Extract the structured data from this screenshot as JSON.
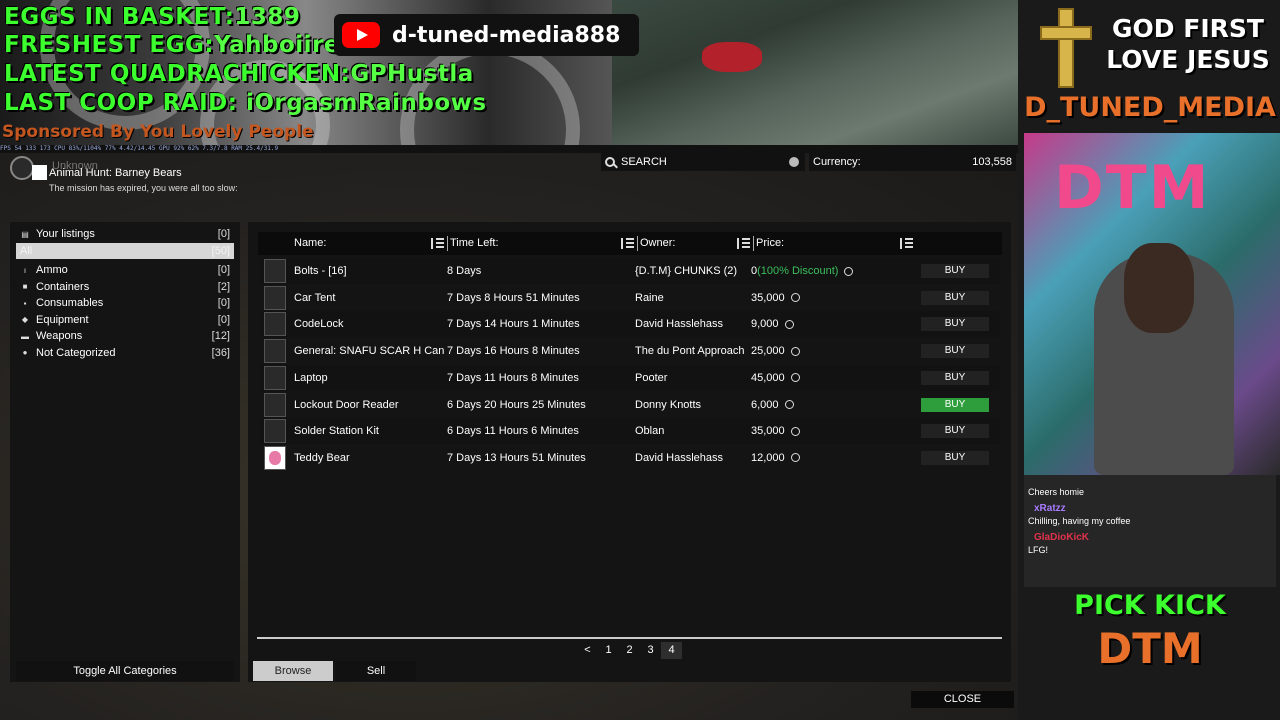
{
  "overlay": {
    "eggs_label": "EGGS IN BASKET:",
    "eggs_value": "1389",
    "freshest_label": "FRESHEST EGG:",
    "freshest_value": "Yahboiirec",
    "quadra_label": "LATEST QUADRACHICKEN:",
    "quadra_value": "GPHustla",
    "raid_label": "LAST COOP RAID:",
    "raid_value": "iOrgasmRainbows",
    "sponsor": "Sponsored By You Lovely People",
    "channel": "d-tuned-media888",
    "perf": "FPS 54  133 173   CPU 83%/1104%  77%  4.42/14.45  GPU 92%  62%  7.3/7.8  RAM 25.4/31.9",
    "god_line1": "GOD FIRST",
    "god_line2": "LOVE JESUS",
    "brand": "D_TUNED_MEDIA",
    "pick_line": "PICK KICK",
    "pick_brand": "DTM",
    "chat": [
      {
        "user": "",
        "message": "Cheers homie"
      },
      {
        "user": "xRatzz",
        "message": "Chilling, having my coffee"
      },
      {
        "user": "GlaDioKicK",
        "message": "LFG!"
      }
    ]
  },
  "mission": {
    "tag": "Unknown",
    "title": "Animal Hunt: Barney Bears",
    "description": "The mission has expired, you were all too slow:"
  },
  "search": {
    "label": "SEARCH"
  },
  "currency": {
    "label": "Currency:",
    "value": "103,558"
  },
  "categories": {
    "your_listings": {
      "label": "Your listings",
      "count": "[0]"
    },
    "all": {
      "label": "All",
      "count": "[50]"
    },
    "items": [
      {
        "label": "Ammo",
        "count": "[0]",
        "icon": "ammo-icon",
        "glyph": "ı"
      },
      {
        "label": "Containers",
        "count": "[2]",
        "icon": "container-icon",
        "glyph": "■"
      },
      {
        "label": "Consumables",
        "count": "[0]",
        "icon": "consumable-icon",
        "glyph": "▪"
      },
      {
        "label": "Equipment",
        "count": "[0]",
        "icon": "equipment-icon",
        "glyph": "◆"
      },
      {
        "label": "Weapons",
        "count": "[12]",
        "icon": "weapon-icon",
        "glyph": "▬"
      },
      {
        "label": "Not Categorized",
        "count": "[36]",
        "icon": "dot-icon",
        "glyph": "●"
      }
    ],
    "toggle_label": "Toggle All Categories"
  },
  "table": {
    "headers": {
      "name": "Name:",
      "time": "Time Left:",
      "owner": "Owner:",
      "price": "Price:"
    },
    "rows": [
      {
        "name": "Bolts - [16]",
        "time": "8 Days",
        "owner": "{D.T.M} CHUNKS (2)",
        "price": "0",
        "discount": "(100% Discount)",
        "buy": "BUY"
      },
      {
        "name": "Car Tent",
        "time": "7 Days 8 Hours 51 Minutes",
        "owner": "Raine",
        "price": "35,000",
        "discount": "",
        "buy": "BUY"
      },
      {
        "name": "CodeLock",
        "time": "7 Days 14 Hours 1 Minutes",
        "owner": "David Hasslehass",
        "price": "9,000",
        "discount": "",
        "buy": "BUY"
      },
      {
        "name": "General: SNAFU SCAR H Can",
        "time": "7 Days 16 Hours 8 Minutes",
        "owner": "The du Pont Approach",
        "price": "25,000",
        "discount": "",
        "buy": "BUY"
      },
      {
        "name": "Laptop",
        "time": "7 Days 11 Hours 8 Minutes",
        "owner": "Pooter",
        "price": "45,000",
        "discount": "",
        "buy": "BUY"
      },
      {
        "name": "Lockout Door Reader",
        "time": "6 Days 20 Hours 25 Minutes",
        "owner": "Donny Knotts",
        "price": "6,000",
        "discount": "",
        "buy": "BUY"
      },
      {
        "name": "Solder Station Kit",
        "time": "6 Days 11 Hours 6 Minutes",
        "owner": "Oblan",
        "price": "35,000",
        "discount": "",
        "buy": "BUY"
      },
      {
        "name": "Teddy Bear",
        "time": "7 Days 13 Hours 51 Minutes",
        "owner": "David Hasslehass",
        "price": "12,000",
        "discount": "",
        "buy": "BUY"
      }
    ]
  },
  "pager": {
    "prev": "<",
    "pages": [
      "1",
      "2",
      "3",
      "4"
    ],
    "current": "4"
  },
  "tabs": {
    "browse": "Browse",
    "sell": "Sell"
  },
  "close_label": "CLOSE",
  "colors": {
    "accent_green": "#2e9e3c",
    "discount_green": "#3bbf5c",
    "overlay_green": "#3cff2e",
    "overlay_orange": "#e8702a"
  }
}
